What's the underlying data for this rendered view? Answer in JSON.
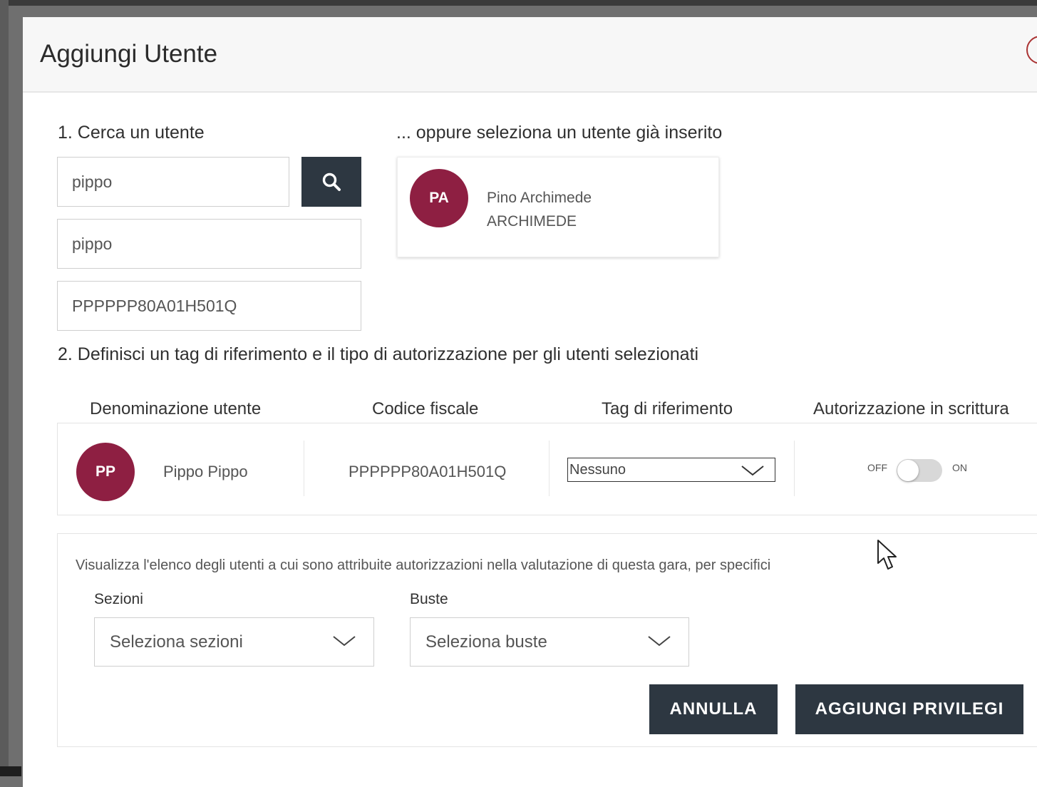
{
  "modal": {
    "title": "Aggiungi Utente"
  },
  "search": {
    "section_label": "1. Cerca un utente",
    "input_1_value": "pippo",
    "input_2_value": "pippo",
    "input_3_value": "PPPPPP80A01H501Q",
    "search_icon": "search-icon"
  },
  "existing": {
    "section_label": "... oppure seleziona un utente già inserito",
    "user": {
      "initials": "PA",
      "name": "Pino Archimede",
      "subtitle": "ARCHIMEDE"
    }
  },
  "define": {
    "section_label": "2. Definisci un tag di riferimento e il tipo di autorizzazione per gli utenti selezionati",
    "columns": [
      "Denominazione utente",
      "Codice fiscale",
      "Tag di riferimento",
      "Autorizzazione in scrittura"
    ],
    "row": {
      "initials": "PP",
      "name": "Pippo Pippo",
      "codice_fiscale": "PPPPPP80A01H501Q",
      "tag_value": "Nessuno",
      "toggle_off_label": "OFF",
      "toggle_on_label": "ON",
      "toggle_state": "off"
    }
  },
  "privileges": {
    "description": "Visualizza l'elenco degli utenti a cui sono attribuite autorizzazioni nella valutazione di questa gara, per specifici",
    "sezioni_label": "Sezioni",
    "sezioni_placeholder": "Seleziona sezioni",
    "buste_label": "Buste",
    "buste_placeholder": "Seleziona buste",
    "cancel_label": "ANNULLA",
    "add_label": "AGGIUNGI PRIVILEGI"
  },
  "colors": {
    "avatar": "#8e1f42",
    "button_dark": "#2d3741",
    "toggle_track": "#d8d8d8"
  }
}
